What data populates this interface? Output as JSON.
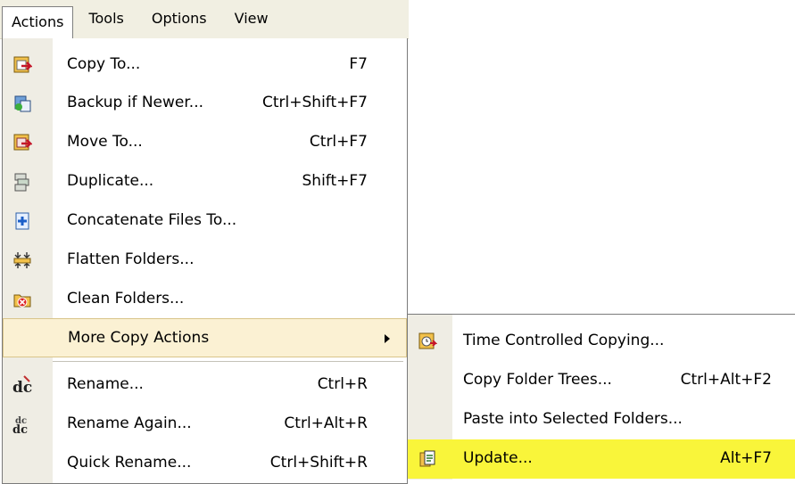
{
  "menubar": {
    "items": [
      {
        "label": "Actions",
        "active": true
      },
      {
        "label": "Tools"
      },
      {
        "label": "Options"
      },
      {
        "label": "View"
      }
    ]
  },
  "actions_menu": {
    "items": [
      {
        "label": "Copy To...",
        "shortcut": "F7",
        "icon": "copy-to-icon"
      },
      {
        "label": "Backup if Newer...",
        "shortcut": "Ctrl+Shift+F7",
        "icon": "backup-icon"
      },
      {
        "label": "Move To...",
        "shortcut": "Ctrl+F7",
        "icon": "move-to-icon"
      },
      {
        "label": "Duplicate...",
        "shortcut": "Shift+F7",
        "icon": "duplicate-icon"
      },
      {
        "label": "Concatenate Files To...",
        "shortcut": "",
        "icon": "concatenate-icon"
      },
      {
        "label": "Flatten Folders...",
        "shortcut": "",
        "icon": "flatten-icon"
      },
      {
        "label": "Clean Folders...",
        "shortcut": "",
        "icon": "clean-folders-icon"
      },
      {
        "label": "More Copy Actions",
        "shortcut": "",
        "submenu": true,
        "highlighted": true
      },
      {
        "label": "Rename...",
        "shortcut": "Ctrl+R",
        "icon": "rename-icon"
      },
      {
        "label": "Rename Again...",
        "shortcut": "Ctrl+Alt+R",
        "icon": "rename-again-icon"
      },
      {
        "label": "Quick Rename...",
        "shortcut": "Ctrl+Shift+R",
        "icon": ""
      }
    ]
  },
  "submenu": {
    "items": [
      {
        "label": "Time Controlled Copying...",
        "shortcut": "",
        "icon": "timed-copy-icon"
      },
      {
        "label": "Copy Folder Trees...",
        "shortcut": "Ctrl+Alt+F2",
        "icon": ""
      },
      {
        "label": "Paste into Selected Folders...",
        "shortcut": "",
        "icon": ""
      },
      {
        "label": "Update...",
        "shortcut": "Alt+F7",
        "icon": "update-icon",
        "highlighted": true
      }
    ]
  },
  "colors": {
    "menubar_bg": "#f1efe2",
    "gutter_bg": "#efede4",
    "hover_bg": "#fbf1d3",
    "highlight_yellow": "#f9f53a"
  }
}
